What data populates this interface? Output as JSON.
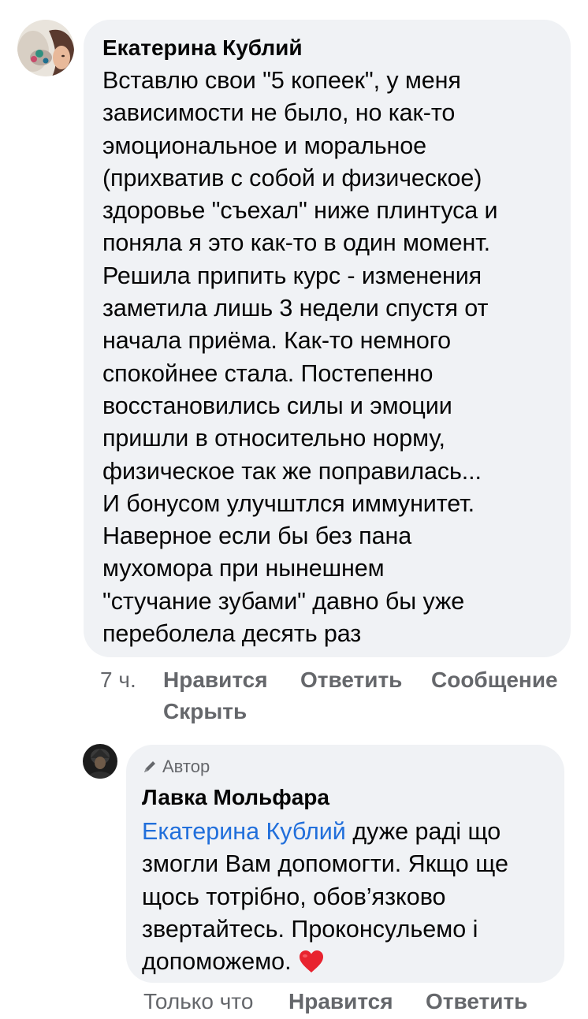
{
  "comment": {
    "author": "Екатерина Кублий",
    "text": "Вставлю свои \"5 копеек\", у меня\nзависимости не было, но как-то\nэмоциональное и моральное\n(прихватив  с собой и физическое)\nздоровье \"съехал\" ниже плинтуса и\nпоняла я это как-то в один момент.\nРешила припить курс - изменения\nзаметила лишь 3 недели спустя от\nначала приёма. Как-то немного\nспокойнее стала. Постепенно\nвосстановились силы и эмоции\nпришли в относительно норму,\nфизическое так же поправилась...\nИ бонусом улучштлся иммунитет.\nНаверное если бы без пана\nмухомора при нынешнем\n\"стучание зубами\" давно бы уже\nпереболела десять раз",
    "time": "7 ч.",
    "actions": {
      "like": "Нравится",
      "reply": "Ответить",
      "message": "Сообщение",
      "hide": "Скрыть"
    }
  },
  "reply": {
    "badge": "Автор",
    "author": "Лавка Мольфара",
    "mention": "Екатерина Кублий",
    "text": " дуже раді що змогли Вам допомогти. Якщо ще щось тотрібно, обов’язково звертайтесь. Проконсульемо і допоможемо. ",
    "emoji": "❤️",
    "time": "Только что",
    "actions": {
      "like": "Нравится",
      "reply": "Ответить"
    }
  },
  "colors": {
    "bubble": "#f0f2f5",
    "secondary_text": "#65676b",
    "link": "#216fdb",
    "heart": "#e8232f"
  },
  "icons": {
    "author_badge": "pen-icon",
    "reaction": "red-heart-emoji"
  }
}
